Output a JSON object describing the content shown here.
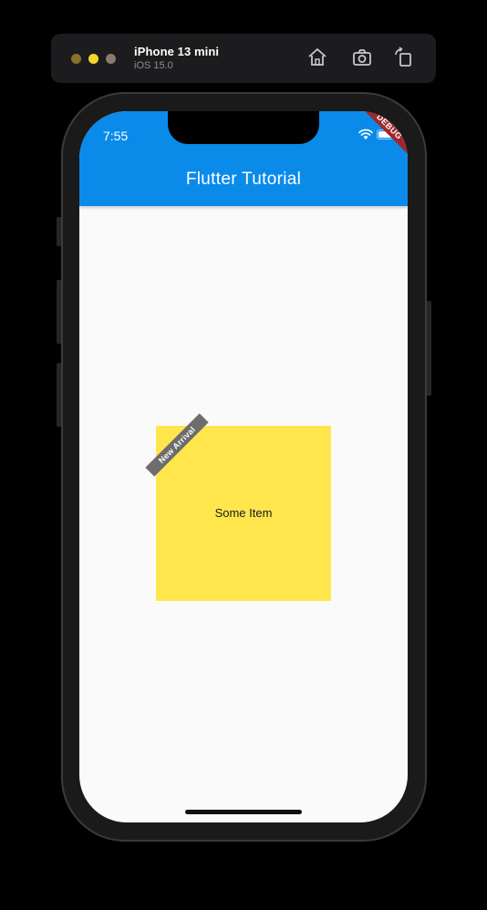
{
  "simulator": {
    "device_name": "iPhone 13 mini",
    "os_version": "iOS 15.0",
    "icons": [
      "home-icon",
      "screenshot-icon",
      "rotate-icon"
    ]
  },
  "status_bar": {
    "time": "7:55",
    "icons": [
      "wifi-icon",
      "battery-icon"
    ]
  },
  "debug_banner": "DEBUG",
  "app_bar": {
    "title": "Flutter Tutorial",
    "color": "#0a8bea"
  },
  "item": {
    "label": "Some Item",
    "banner": "New Arrival",
    "color": "#ffe64c"
  }
}
